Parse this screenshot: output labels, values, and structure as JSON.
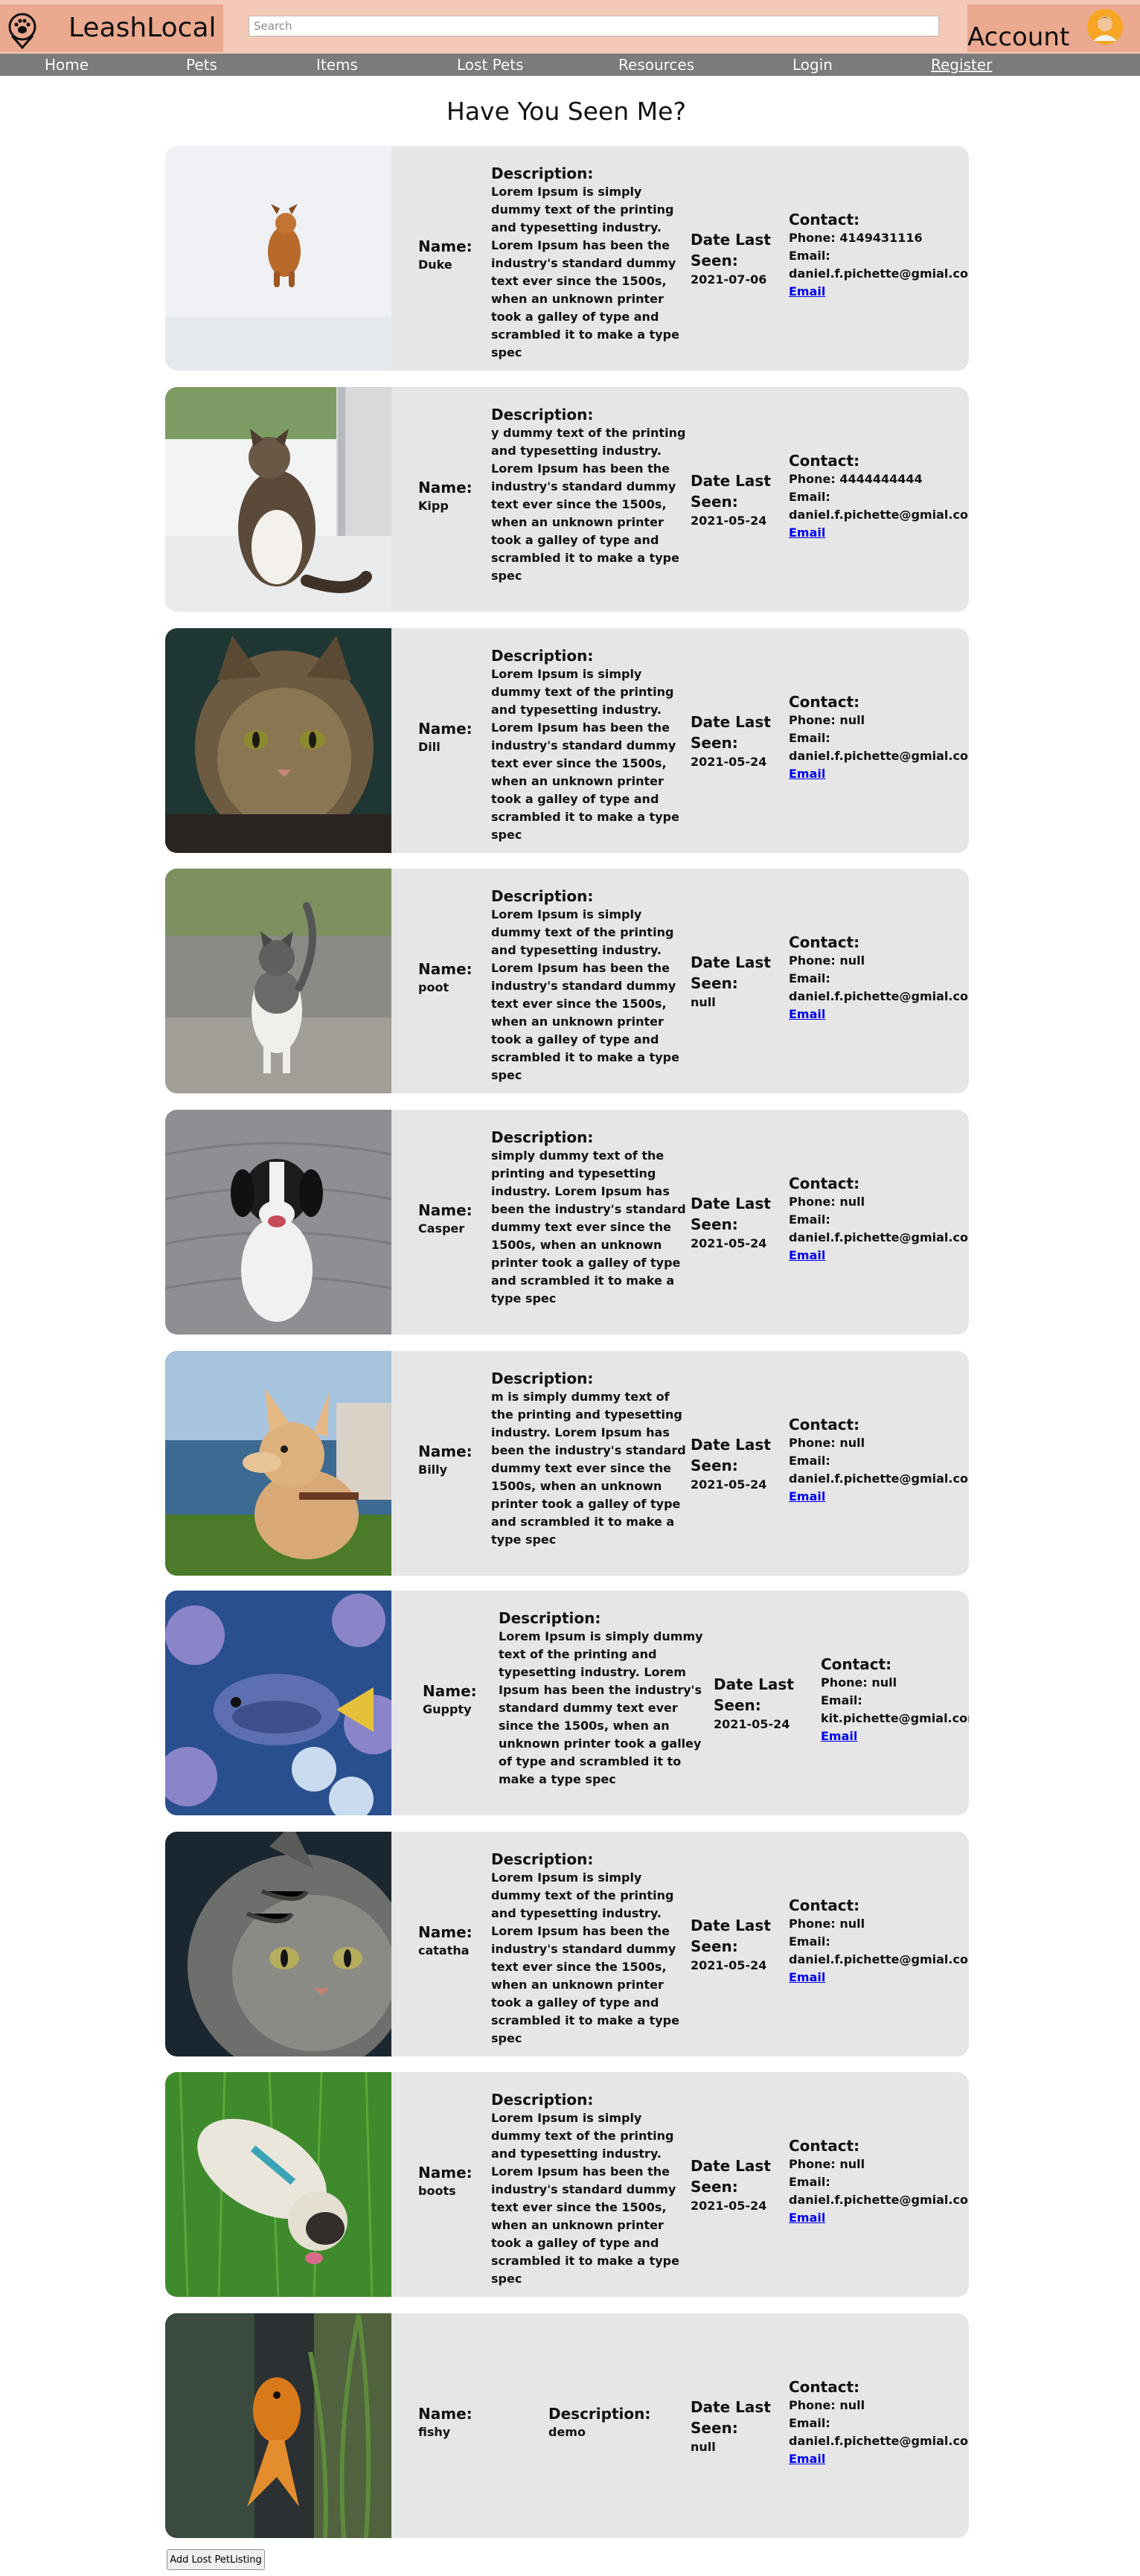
{
  "header": {
    "brand": "LeashLocal",
    "search_placeholder": "Search",
    "account_label": "Account"
  },
  "nav": {
    "items": [
      "Home",
      "Pets",
      "Items",
      "Lost Pets",
      "Resources",
      "Login",
      "Register"
    ]
  },
  "page": {
    "title": "Have You Seen Me?"
  },
  "labels": {
    "name": "Name:",
    "description": "Description:",
    "date": "Date Last Seen:",
    "contact": "Contact:",
    "email_link": "Email"
  },
  "listings": [
    {
      "name": "Duke",
      "description": "Lorem Ipsum is simply dummy text of the printing and typesetting industry. Lorem Ipsum has been the industry's standard dummy text ever since the 1500s, when an unknown printer took a galley of type and scrambled it to make a type spec",
      "date": "2021-07-06",
      "phone": "Phone: 4149431116",
      "email_label": "Email:",
      "email": "daniel.f.pichette@gmial.com",
      "photo": "dog-running-snow"
    },
    {
      "name": "Kipp",
      "description": "y dummy text of the printing and typesetting industry. Lorem Ipsum has been the industry's standard dummy text ever since the 1500s, when an unknown printer took a galley of type and scrambled it to make a type spec",
      "date": "2021-05-24",
      "phone": "Phone: 4444444444",
      "email_label": "Email:",
      "email": "daniel.f.pichette@gmial.com",
      "photo": "cat-at-door"
    },
    {
      "name": "Dill",
      "description": "Lorem Ipsum is simply dummy text of the printing and typesetting industry. Lorem Ipsum has been the industry's standard dummy text ever since the 1500s, when an unknown printer took a galley of type and scrambled it to make a type spec",
      "date": "2021-05-24",
      "phone": "Phone: null",
      "email_label": "Email:",
      "email": "daniel.f.pichette@gmial.com",
      "photo": "orange-cat-closeup"
    },
    {
      "name": "poot",
      "description": "Lorem Ipsum is simply dummy text of the printing and typesetting industry. Lorem Ipsum has been the industry's standard dummy text ever since the 1500s, when an unknown printer took a galley of type and scrambled it to make a type spec",
      "date": "null",
      "phone": "Phone: null",
      "email_label": "Email:",
      "email": "daniel.f.pichette@gmial.com",
      "photo": "cat-walking-street"
    },
    {
      "name": "Casper",
      "description": "simply dummy text of the printing and typesetting industry. Lorem Ipsum has been the industry's standard dummy text ever since the 1500s, when an unknown printer took a galley of type and scrambled it to make a type spec",
      "date": "2021-05-24",
      "phone": "Phone: null",
      "email_label": "Email:",
      "email": "daniel.f.pichette@gmial.com",
      "photo": "dog-sitting-pavement"
    },
    {
      "name": "Billy",
      "description": "m is simply dummy text of the printing and typesetting industry. Lorem Ipsum has been the industry's standard dummy text ever since the 1500s, when an unknown printer took a galley of type and scrambled it to make a type spec",
      "date": "2021-05-24",
      "phone": "Phone: null",
      "email_label": "Email:",
      "email": "daniel.f.pichette@gmial.com",
      "photo": "chihuahua-outdoors"
    },
    {
      "name": "Guppty",
      "description": "Lorem Ipsum is simply dummy text of the printing and typesetting industry. Lorem Ipsum has been the industry's standard dummy text ever since the 1500s, when an unknown printer took a galley of type and scrambled it to make a type spec",
      "date": "2021-05-24",
      "phone": "Phone: null",
      "email_label": "Email:",
      "email": "kit.pichette@gmial.com",
      "photo": "blue-tang-fish"
    },
    {
      "name": "catatha",
      "description": "Lorem Ipsum is simply dummy text of the printing and typesetting industry. Lorem Ipsum has been the industry's standard dummy text ever since the 1500s, when an unknown printer took a galley of type and scrambled it to make a type spec",
      "date": "2021-05-24",
      "phone": "Phone: null",
      "email_label": "Email:",
      "email": "daniel.f.pichette@gmial.com",
      "photo": "tabby-cat-closeup"
    },
    {
      "name": "boots",
      "description": "Lorem Ipsum is simply dummy text of the printing and typesetting industry. Lorem Ipsum has been the industry's standard dummy text ever since the 1500s, when an unknown printer took a galley of type and scrambled it to make a type spec",
      "date": "2021-05-24",
      "phone": "Phone: null",
      "email_label": "Email:",
      "email": "daniel.f.pichette@gmial.com",
      "photo": "pug-on-grass"
    },
    {
      "name": "fishy",
      "description": "demo",
      "date": "null",
      "phone": "Phone: null",
      "email_label": "Email:",
      "email": "daniel.f.pichette@gmial.com",
      "photo": "goldfish"
    }
  ],
  "footer": {
    "add_button": "Add Lost PetListing"
  }
}
